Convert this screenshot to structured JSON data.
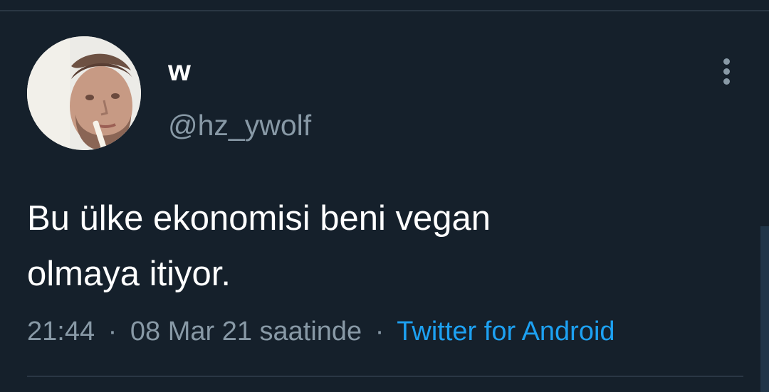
{
  "tweet": {
    "display_name": "w",
    "handle": "@hz_ywolf",
    "text_line1": "Bu ülke ekonomisi beni vegan",
    "text_line2": "olmaya itiyor.",
    "time": "21:44",
    "date": "08 Mar 21 saatinde",
    "separator": "·",
    "source": "Twitter for Android"
  },
  "icons": {
    "more": "more-vertical-icon",
    "avatar": "profile-photo"
  },
  "colors": {
    "background": "#15202b",
    "divider": "#2a3744",
    "text_primary": "#ffffff",
    "text_secondary": "#8899a6",
    "link": "#1da1f2"
  }
}
